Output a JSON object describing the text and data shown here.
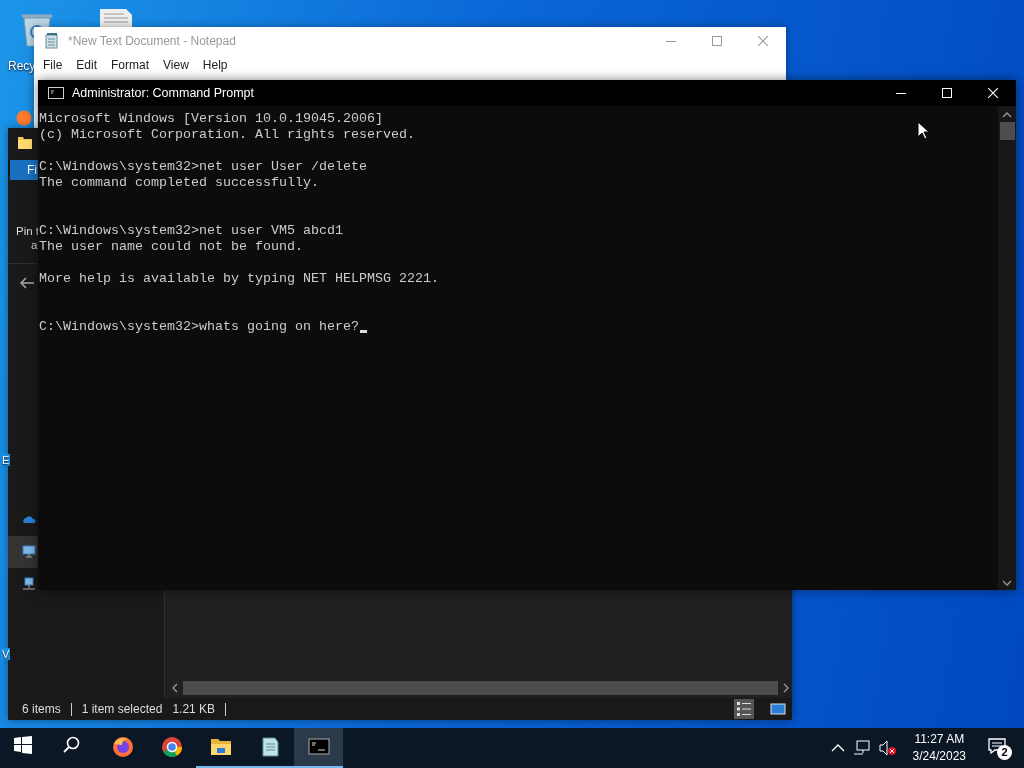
{
  "desktop": {
    "icons": [
      {
        "kind": "recycle-bin",
        "label": "Recy"
      },
      {
        "kind": "document"
      },
      {
        "kind": "browser"
      }
    ],
    "labels": [
      "E",
      "V"
    ]
  },
  "notepad": {
    "title": "*New Text Document - Notepad",
    "menu": [
      "File",
      "Edit",
      "Format",
      "View",
      "Help"
    ]
  },
  "explorer": {
    "ribbon_tab": "Fi",
    "ribbon_text": [
      "Pin t",
      "a"
    ],
    "nav": [
      {
        "kind": "cloud",
        "selected": false
      },
      {
        "kind": "pc",
        "selected": true
      },
      {
        "kind": "network",
        "selected": false
      }
    ],
    "status": [
      "6 items",
      "1 item selected",
      "1.21 KB"
    ],
    "view_buttons": [
      {
        "kind": "details",
        "selected": true
      },
      {
        "kind": "thumbnails",
        "selected": false
      }
    ]
  },
  "command_prompt": {
    "title": "Administrator: Command Prompt",
    "blocks": [
      [
        "Microsoft Windows [Version 10.0.19045.2006]",
        "(c) Microsoft Corporation. All rights reserved."
      ],
      [
        "C:\\Windows\\system32>net user User /delete",
        "The command completed successfully."
      ],
      [
        "C:\\Windows\\system32>net user VM5 abcd1",
        "The user name could not be found."
      ],
      [
        "More help is available by typing NET HELPMSG 2221."
      ],
      [
        "C:\\Windows\\system32>whats going on here?"
      ]
    ]
  },
  "taskbar": {
    "apps": [
      {
        "kind": "start",
        "open": false,
        "active": false
      },
      {
        "kind": "search",
        "open": false,
        "active": false
      },
      {
        "kind": "firefox",
        "open": false,
        "active": false
      },
      {
        "kind": "chrome",
        "open": false,
        "active": false
      },
      {
        "kind": "files",
        "open": true,
        "active": false
      },
      {
        "kind": "notepad",
        "open": true,
        "active": false
      },
      {
        "kind": "terminal",
        "open": true,
        "active": true
      }
    ],
    "time": "11:27 AM",
    "date": "3/24/2023",
    "notifications": "2"
  }
}
